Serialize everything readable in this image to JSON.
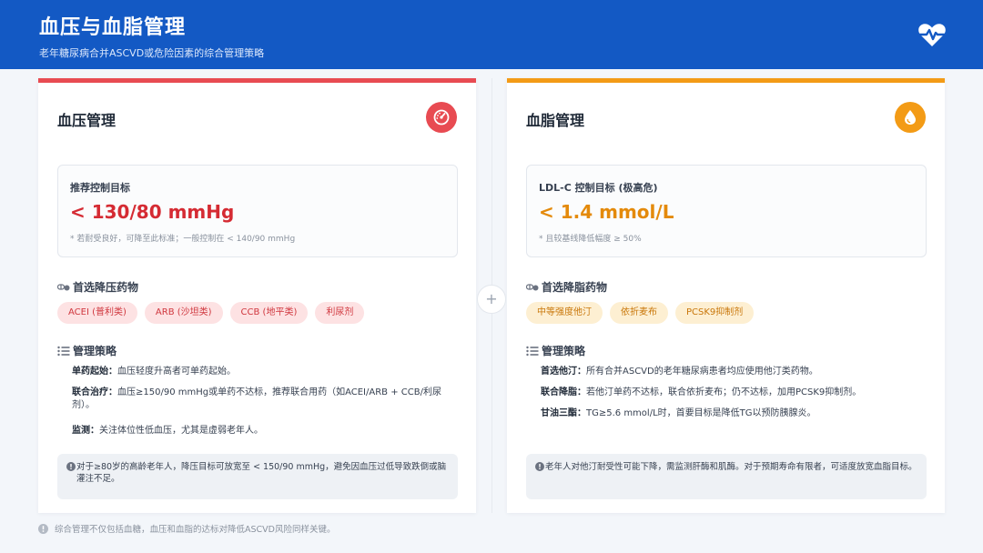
{
  "header": {
    "title": "血压与血脂管理",
    "subtitle": "老年糖尿病合并ASCVD或危险因素的综合管理策略",
    "icon": "heart-pulse-icon"
  },
  "colors": {
    "header_bg": "#1359c4",
    "bp_accent": "#e84b52",
    "lipid_accent": "#f39b16"
  },
  "bp_card": {
    "title": "血压管理",
    "icon": "gauge-icon",
    "target": {
      "label": "推荐控制目标",
      "value": "< 130/80 mmHg",
      "note": "* 若耐受良好，可降至此标准；一般控制在 < 140/90 mmHg"
    },
    "drugs_heading": "首选降压药物",
    "drugs": [
      "ACEI (普利类)",
      "ARB (沙坦类)",
      "CCB (地平类)",
      "利尿剂"
    ],
    "strategy_heading": "管理策略",
    "strategies": [
      {
        "label": "单药起始：",
        "text": "血压轻度升高者可单药起始。"
      },
      {
        "label": "联合治疗：",
        "text": "血压≥150/90 mmHg或单药不达标，推荐联合用药（如ACEI/ARB + CCB/利尿剂）。"
      },
      {
        "label": "监测：",
        "text": "关注体位性低血压，尤其是虚弱老年人。"
      }
    ],
    "note": "对于≥80岁的高龄老年人，降压目标可放宽至 < 150/90 mmHg，避免因血压过低导致跌倒或脑灌注不足。"
  },
  "lipid_card": {
    "title": "血脂管理",
    "icon": "drop-icon",
    "target": {
      "label": "LDL-C 控制目标 (极高危)",
      "value": "< 1.4 mmol/L",
      "note": "* 且较基线降低幅度 ≥ 50%"
    },
    "drugs_heading": "首选降脂药物",
    "drugs": [
      "中等强度他汀",
      "依折麦布",
      "PCSK9抑制剂"
    ],
    "strategy_heading": "管理策略",
    "strategies": [
      {
        "label": "首选他汀：",
        "text": "所有合并ASCVD的老年糖尿病患者均应使用他汀类药物。"
      },
      {
        "label": "联合降脂：",
        "text": "若他汀单药不达标，联合依折麦布；仍不达标，加用PCSK9抑制剂。"
      },
      {
        "label": "甘油三酯：",
        "text": "TG≥5.6 mmol/L时，首要目标是降低TG以预防胰腺炎。"
      }
    ],
    "note": "老年人对他汀耐受性可能下降，需监测肝酶和肌酶。对于预期寿命有限者，可适度放宽血脂目标。"
  },
  "connector": {
    "symbol": "+"
  },
  "footer": {
    "text": "综合管理不仅包括血糖，血压和血脂的达标对降低ASCVD风险同样关键。"
  }
}
